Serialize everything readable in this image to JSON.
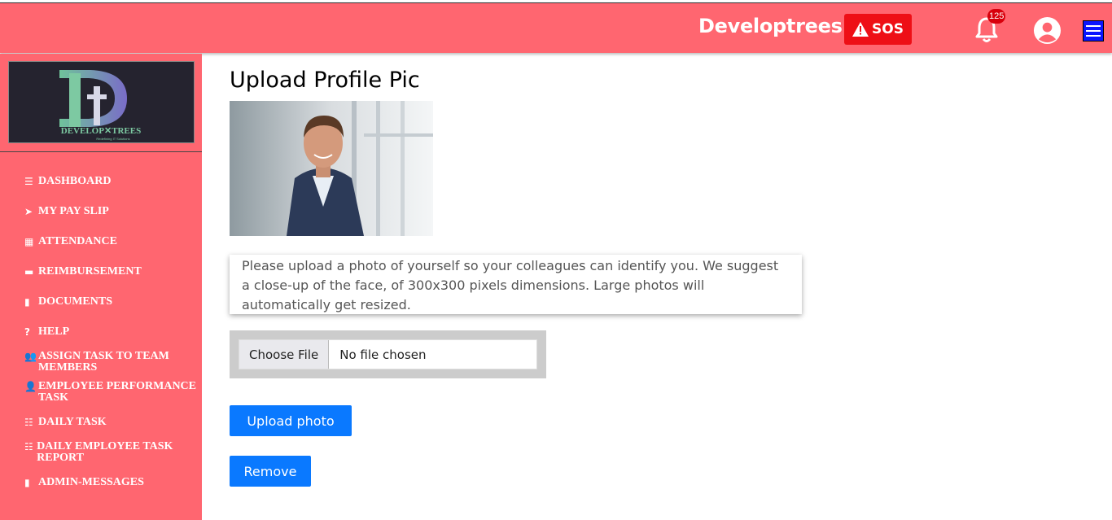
{
  "header": {
    "brand": "Developtrees",
    "sos_label": "SOS",
    "notification_count": "125",
    "bg_color": "#ff6670"
  },
  "sidebar": {
    "logo_text": "DEVELOPTREES",
    "items": [
      {
        "label": "DASHBOARD",
        "icon": "bars-icon"
      },
      {
        "label": "MY PAY SLIP",
        "icon": "paper-plane-icon"
      },
      {
        "label": "ATTENDANCE",
        "icon": "calendar-icon"
      },
      {
        "label": "REIMBURSEMENT",
        "icon": "credit-card-icon"
      },
      {
        "label": "DOCUMENTS",
        "icon": "file-icon"
      },
      {
        "label": "HELP",
        "icon": "question-circle-icon"
      },
      {
        "label": "ASSIGN TASK TO TEAM MEMBERS",
        "icon": "users-icon"
      },
      {
        "label": "EMPLOYEE PERFORMANCE TASK",
        "icon": "user-edit-icon"
      },
      {
        "label": "DAILY TASK",
        "icon": "list-check-icon"
      },
      {
        "label": "DAILY EMPLOYEE TASK REPORT",
        "icon": "list-check-icon"
      },
      {
        "label": "ADMIN-MESSAGES",
        "icon": "file-icon"
      }
    ]
  },
  "main": {
    "title": "Upload Profile Pic",
    "hint": "Please upload a photo of yourself so your colleagues can identify you. We suggest a close-up of the face, of 300x300 pixels dimensions. Large photos will automatically get resized.",
    "file_button": "Choose File",
    "file_status": "No file chosen",
    "upload_button": "Upload photo",
    "remove_button": "Remove"
  }
}
